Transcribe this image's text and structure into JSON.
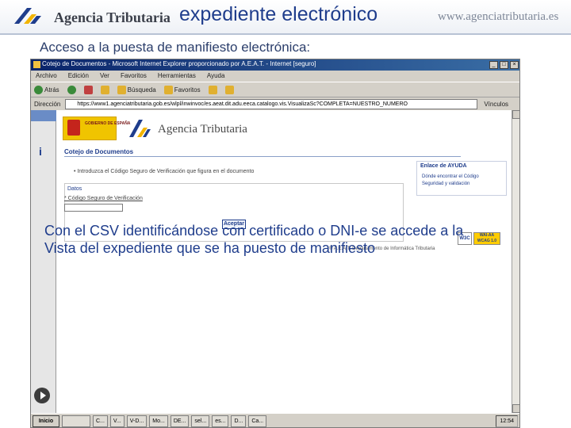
{
  "header": {
    "agency_name": "Agencia Tributaria",
    "title": "expediente electrónico",
    "website": "www.agenciatributaria.es"
  },
  "subtitle": "Acceso a la puesta de manifiesto electrónica:",
  "browser": {
    "title": "Cotejo de Documentos - Microsoft Internet Explorer proporcionado por A.E.A.T. - Internet [seguro]",
    "menu": [
      "Archivo",
      "Edición",
      "Ver",
      "Favoritos",
      "Herramientas",
      "Ayuda"
    ],
    "toolbar": {
      "back_label": "Atrás",
      "search_label": "Búsqueda",
      "favorites_label": "Favoritos"
    },
    "address_label": "Dirección",
    "address_value": "https://www1.agenciatributaria.gob.es/wlpl/inwinvoc/es.aeat.dit.adu.eeca.catalogo.vis.VisualizaSc?COMPLETA=NUESTRO_NUMERO",
    "links_label": "Vínculos",
    "window_buttons": [
      "_",
      "□",
      "×"
    ]
  },
  "page": {
    "gobierno_text": "GOBIERNO DE ESPAÑA",
    "agency_name": "Agencia Tributaria",
    "section_title": "Cotejo de Documentos",
    "bullet_text": "Introduzca el Código Seguro de Verificación que figura en el documento",
    "datos_label": "Datos",
    "csv_label": "* Código Seguro de Verificación",
    "accept_label": "Aceptar",
    "help": {
      "title": "Enlace de AYUDA",
      "link1": "Dónde encontrar el Código",
      "link2": "Seguridad y validación"
    },
    "footer": "© A.E.A.T. Departamento de Informática Tributaria",
    "w3c_label": "W3C",
    "wai_label": "WAI-AA WCAG 1.0"
  },
  "overlay_text": "Con el CSV identificándose con certificado o DNI-e se accede a la Vista del expediente que se ha puesto de manifiesto",
  "taskbar": {
    "start_label": "Inicio",
    "items": [
      "C...",
      "V...",
      "V-D...",
      "Mo...",
      "DE...",
      "sel...",
      "es...",
      "D...",
      "Ca..."
    ],
    "clock": "12:54"
  }
}
